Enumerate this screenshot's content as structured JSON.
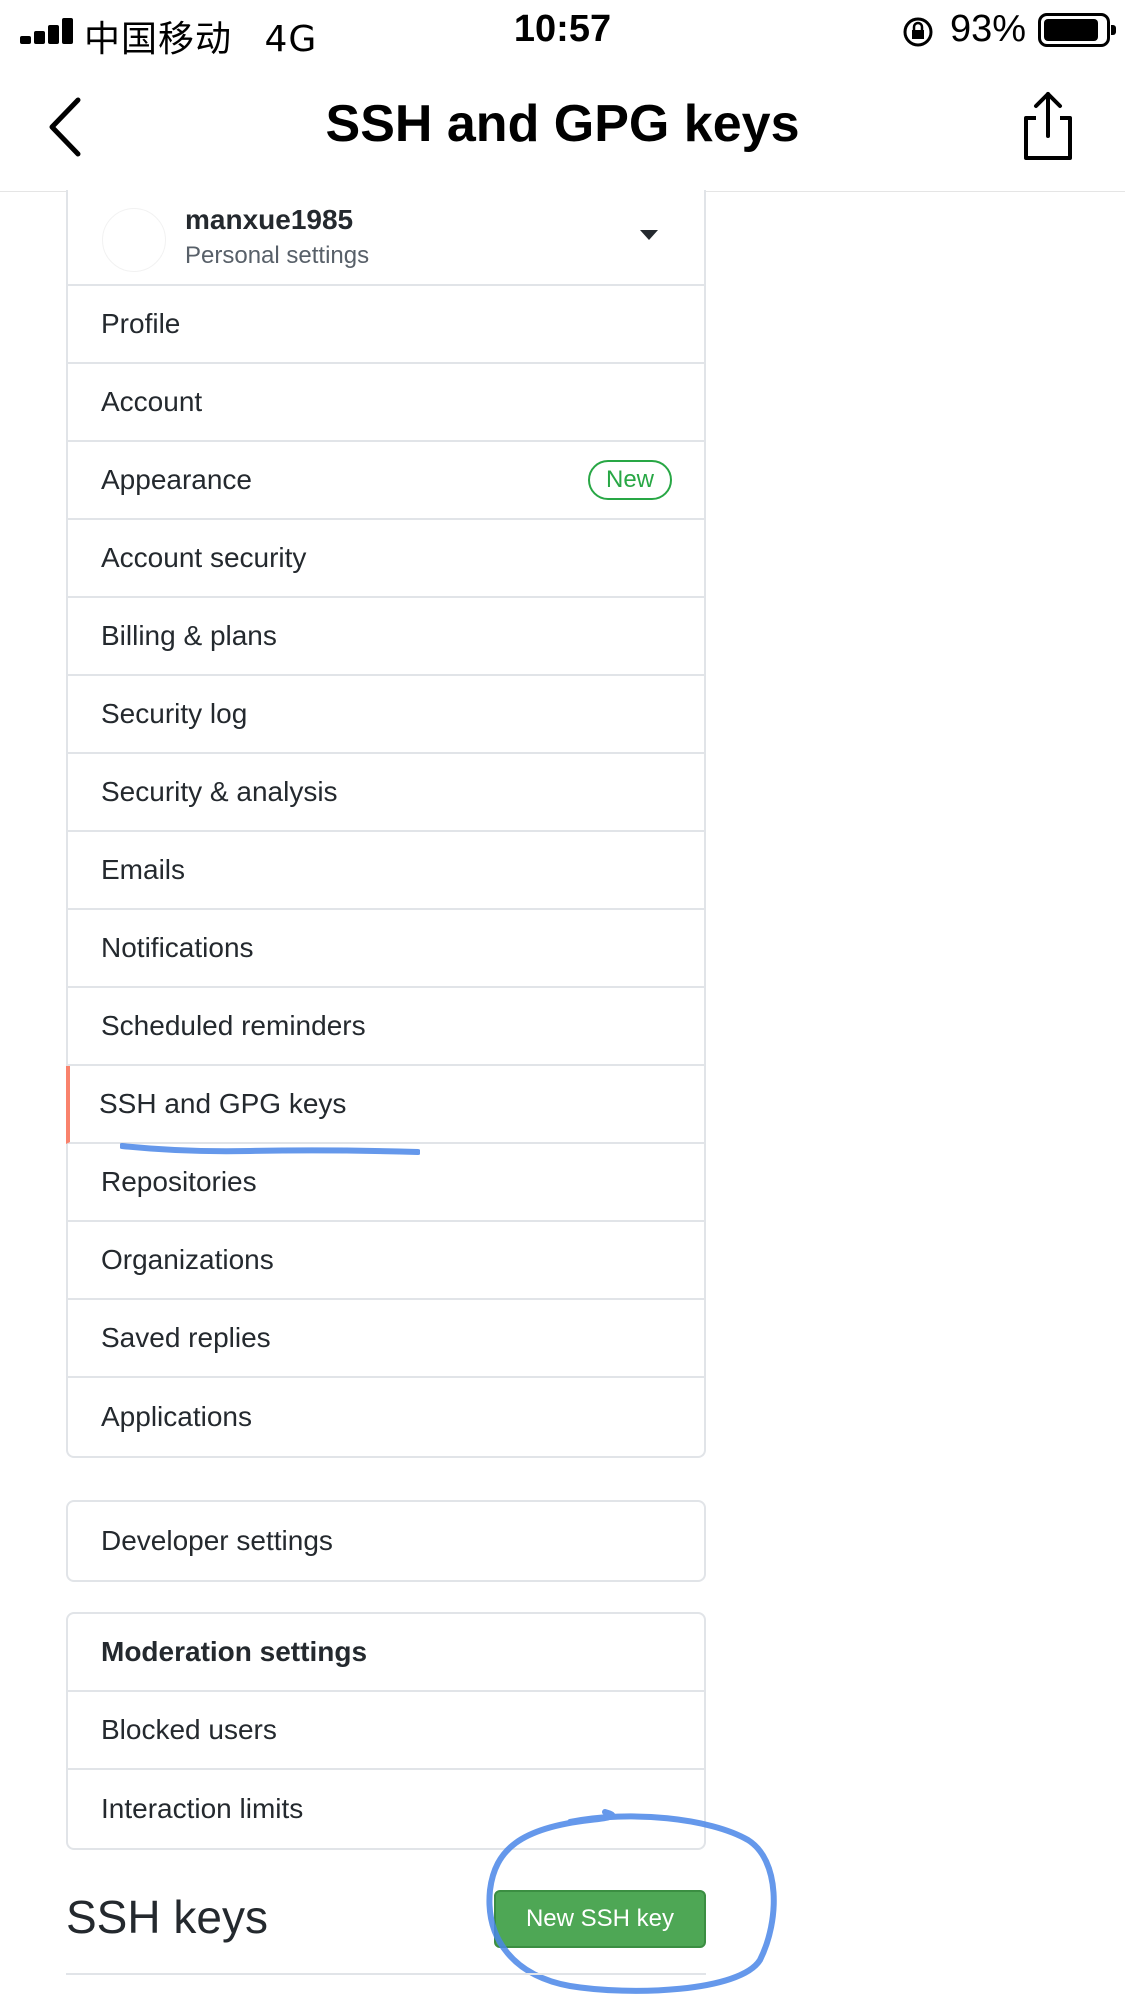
{
  "status_bar": {
    "carrier": "中国移动",
    "network": "4G",
    "time": "10:57",
    "battery_percent": "93%",
    "battery_level": 0.93
  },
  "nav": {
    "title": "SSH and GPG keys",
    "back_icon": "chevron-left-icon",
    "share_icon": "share-icon"
  },
  "account": {
    "username": "manxue1985",
    "subtitle": "Personal settings"
  },
  "menu": {
    "items": [
      {
        "label": "Profile"
      },
      {
        "label": "Account"
      },
      {
        "label": "Appearance",
        "badge": "New"
      },
      {
        "label": "Account security"
      },
      {
        "label": "Billing & plans"
      },
      {
        "label": "Security log"
      },
      {
        "label": "Security & analysis"
      },
      {
        "label": "Emails"
      },
      {
        "label": "Notifications"
      },
      {
        "label": "Scheduled reminders"
      },
      {
        "label": "SSH and GPG keys",
        "selected": true
      },
      {
        "label": "Repositories"
      },
      {
        "label": "Organizations"
      },
      {
        "label": "Saved replies"
      },
      {
        "label": "Applications"
      }
    ]
  },
  "developer": {
    "label": "Developer settings"
  },
  "moderation": {
    "header": "Moderation settings",
    "items": [
      {
        "label": "Blocked users"
      },
      {
        "label": "Interaction limits"
      }
    ]
  },
  "ssh_section": {
    "title": "SSH keys",
    "new_button": "New SSH key"
  },
  "colors": {
    "accent_selected": "#f9826c",
    "badge_green": "#28a745",
    "button_green": "#4ea755",
    "annotation_blue": "#4a86e8"
  }
}
